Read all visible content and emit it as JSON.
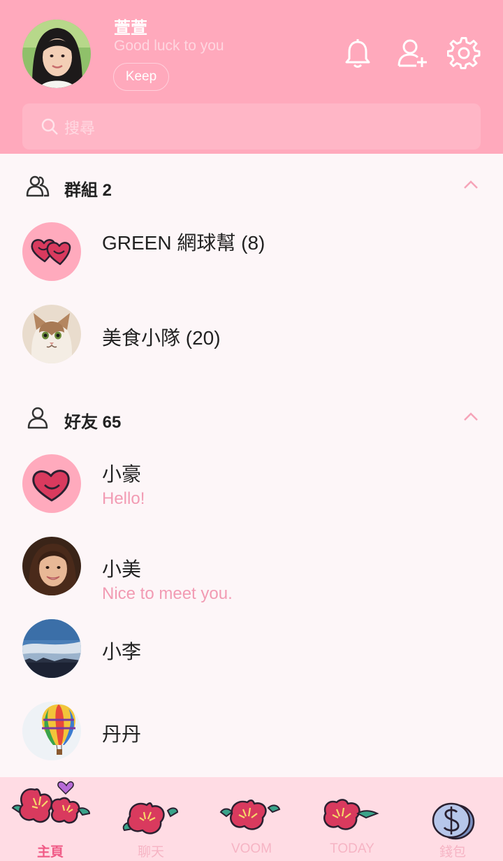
{
  "profile": {
    "name": "萱萱",
    "status": "Good luck to you",
    "keep_label": "Keep"
  },
  "search": {
    "placeholder": "搜尋"
  },
  "groups_section": {
    "title": "群組 2"
  },
  "groups": [
    {
      "name": "GREEN 網球幫 (8)"
    },
    {
      "name": "美食小隊 (20)"
    }
  ],
  "friends_section": {
    "title": "好友 65"
  },
  "friends": [
    {
      "name": "小豪",
      "message": "Hello!"
    },
    {
      "name": "小美",
      "message": "Nice to meet you."
    },
    {
      "name": "小李",
      "message": ""
    },
    {
      "name": "丹丹",
      "message": ""
    }
  ],
  "tabs": [
    {
      "label": "主頁",
      "icon": "flower-icon",
      "active": true
    },
    {
      "label": "聊天",
      "icon": "flower-icon",
      "active": false
    },
    {
      "label": "VOOM",
      "icon": "flower-icon",
      "active": false
    },
    {
      "label": "TODAY",
      "icon": "flower-icon",
      "active": false
    },
    {
      "label": "錢包",
      "icon": "coin-icon",
      "active": false
    }
  ],
  "colors": {
    "header": "#ffa9bc",
    "accent": "#f05a86",
    "message": "#f29bb3",
    "heart": "#d93a5e",
    "tabbar": "#ffdce4"
  }
}
